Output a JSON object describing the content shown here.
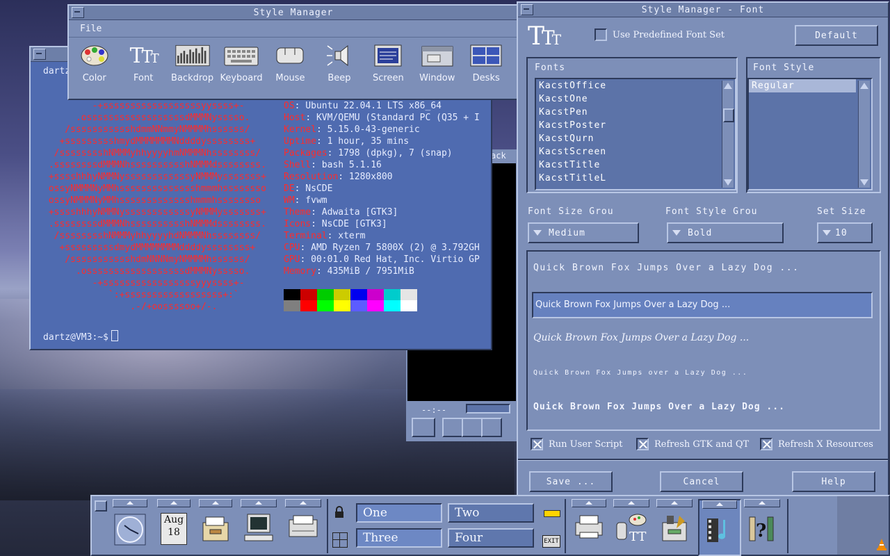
{
  "style_manager": {
    "title": "Style Manager",
    "menu_file": "File",
    "tools": [
      {
        "label": "Color",
        "icon": "palette-icon"
      },
      {
        "label": "Font",
        "icon": "font-icon"
      },
      {
        "label": "Backdrop",
        "icon": "backdrop-icon"
      },
      {
        "label": "Keyboard",
        "icon": "keyboard-icon"
      },
      {
        "label": "Mouse",
        "icon": "mouse-icon"
      },
      {
        "label": "Beep",
        "icon": "speaker-icon"
      },
      {
        "label": "Screen",
        "icon": "screen-icon"
      },
      {
        "label": "Window",
        "icon": "window-icon"
      },
      {
        "label": "Desks",
        "icon": "desks-icon"
      }
    ]
  },
  "terminal": {
    "title": "dartz",
    "prompt": "dartz@VM3:~$",
    "ascii_lines": [
      "         -+ssssssssssssssssssyyssss+-",
      "      .ossssssssssssssssssdMMMNysssso.",
      "    /ssssssssssshdmmNNmmyNMMMMhssssss/",
      "   +ssssssssshmydMMMMMMMNddddyssssssss+",
      "  /sssssssshNMMMyhhyyyyhmNMMMNhssssssss/",
      " .ssssssssdMMMNhsssssssssshNMMMdssssssss.",
      " +sssshhhyNMMNyssssssssssssyNMMMysssssss+",
      " ossyNMMMNyMMhsssssssssssssshmmmhssssssso",
      " ossyNMMMNyMMhssssssssssssshmmmhssssssso",
      " +sssshhhyNMMNyssssssssssssyNMMMysssssss+",
      " .ssssssssdMMMNhsssssssssshNMMMdssssssss.",
      "  /sssssssshNMMMyhhyyyyhdNMMMNhssssssss/",
      "   +sssssssssdmydMMMMMMMMddddyssssssss+",
      "    /ssssssssssshdmNNNNmyNMMMMhssssss/",
      "      .ossssssssssssssssssdMMMNysssso.",
      "         -+sssssssssssssssssyyyssss+-",
      "            `:+ssssssssssssssssss+:`",
      "                .-/+oossssoo+/-."
    ],
    "info": [
      {
        "key": "OS",
        "value": "Ubuntu 22.04.1 LTS x86_64"
      },
      {
        "key": "Host",
        "value": "KVM/QEMU (Standard PC (Q35 + I"
      },
      {
        "key": "Kernel",
        "value": "5.15.0-43-generic"
      },
      {
        "key": "Uptime",
        "value": "1 hour, 35 mins"
      },
      {
        "key": "Packages",
        "value": "1798 (dpkg), 7 (snap)"
      },
      {
        "key": "Shell",
        "value": "bash 5.1.16"
      },
      {
        "key": "Resolution",
        "value": "1280x800"
      },
      {
        "key": "DE",
        "value": "NsCDE"
      },
      {
        "key": "WM",
        "value": "fvwm"
      },
      {
        "key": "Theme",
        "value": "Adwaita [GTK3]"
      },
      {
        "key": "Icons",
        "value": "NsCDE [GTK3]"
      },
      {
        "key": "Terminal",
        "value": "xterm"
      },
      {
        "key": "CPU",
        "value": "AMD Ryzen 7 5800X (2) @ 3.792GH"
      },
      {
        "key": "GPU",
        "value": "00:01.0 Red Hat, Inc. Virtio GP"
      },
      {
        "key": "Memory",
        "value": "435MiB / 7951MiB"
      }
    ],
    "palette_top": [
      "#000000",
      "#cc0000",
      "#00cc00",
      "#cccc00",
      "#0000ee",
      "#cc00cc",
      "#00cccc",
      "#e5e5e5"
    ],
    "palette_bottom": [
      "#7f7f7f",
      "#ff0000",
      "#00ff00",
      "#ffff00",
      "#5c5cff",
      "#ff00ff",
      "#00ffff",
      "#ffffff"
    ]
  },
  "dark_window": {
    "title_fragment": "ack",
    "clock_text": "--:--"
  },
  "font_dialog": {
    "title": "Style Manager - Font",
    "use_predefined_label": "Use Predefined Font Set",
    "default_btn": "Default",
    "fonts_label": "Fonts",
    "fonts": [
      "KacstOffice",
      "KacstOne",
      "KacstPen",
      "KacstPoster",
      "KacstQurn",
      "KacstScreen",
      "KacstTitle",
      "KacstTitleL"
    ],
    "font_style_label": "Font Style",
    "font_styles": [
      "Regular"
    ],
    "font_size_group_label": "Font Size Grou",
    "font_size_group_value": "Medium",
    "font_style_group_label": "Font Style Grou",
    "font_style_group_value": "Bold",
    "set_size_label": "Set Size",
    "set_size_value": "10",
    "previews": [
      "Quick Brown Fox Jumps Over a Lazy Dog ...",
      "Quick Brown Fox Jumps Over a Lazy Dog ...",
      "Quick Brown Fox Jumps Over a Lazy Dog ...",
      "Quick Brown Fox Jumps over a Lazy Dog ...",
      "Quick Brown Fox Jumps Over a Lazy Dog ..."
    ],
    "run_user_script": "Run User Script",
    "refresh_gtk_qt": "Refresh GTK and QT",
    "refresh_x": "Refresh X Resources",
    "save_btn": "Save ...",
    "cancel_btn": "Cancel",
    "help_btn": "Help"
  },
  "front_panel": {
    "calendar_month": "Aug",
    "calendar_day": "18",
    "workspaces": [
      "One",
      "Two",
      "Three",
      "Four"
    ],
    "exit_label": "EXIT"
  }
}
